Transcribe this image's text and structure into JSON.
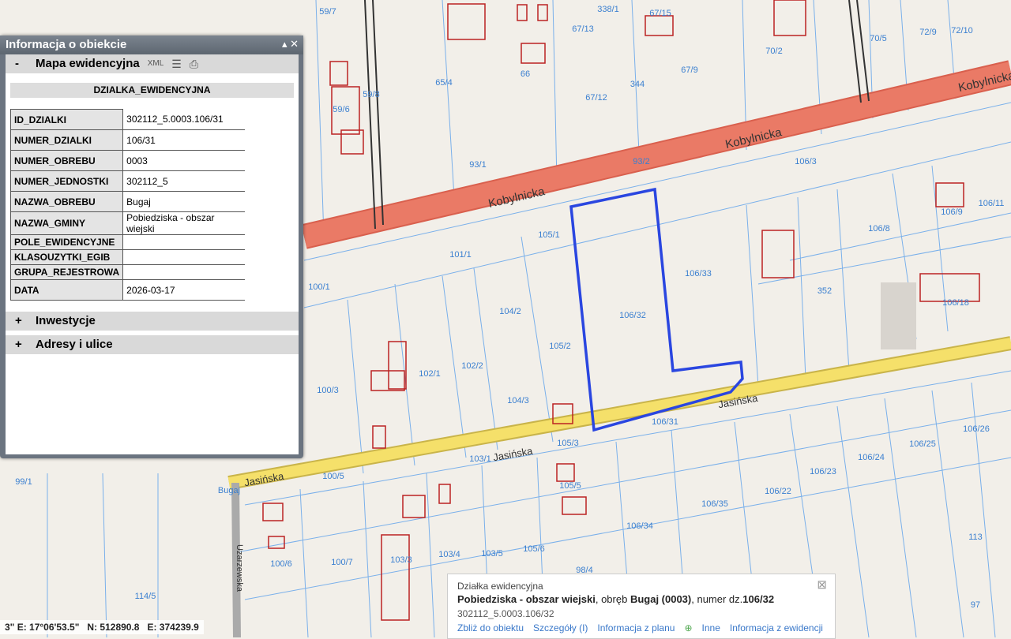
{
  "panel": {
    "title": "Informacja o obiekcie",
    "section": "Mapa ewidencyjna",
    "section_sign": "-",
    "xml": "XML",
    "dz_header": "DZIALKA_EWIDENCYJNA",
    "rows": [
      {
        "k": "ID_DZIALKI",
        "v": "302112_5.0003.106/31"
      },
      {
        "k": "NUMER_DZIALKI",
        "v": "106/31"
      },
      {
        "k": "NUMER_OBREBU",
        "v": "0003"
      },
      {
        "k": "NUMER_JEDNOSTKI",
        "v": "302112_5"
      },
      {
        "k": "NAZWA_OBREBU",
        "v": "Bugaj"
      },
      {
        "k": "NAZWA_GMINY",
        "v": "Pobiedziska - obszar wiejski"
      },
      {
        "k": "POLE_EWIDENCYJNE",
        "v": ""
      },
      {
        "k": "KLASOUZYTKI_EGIB",
        "v": ""
      },
      {
        "k": "GRUPA_REJESTROWA",
        "v": ""
      },
      {
        "k": "DATA",
        "v": "2026-03-17"
      }
    ],
    "sections": [
      {
        "sign": "+",
        "label": "Inwestycje"
      },
      {
        "sign": "+",
        "label": "Adresy i ulice"
      }
    ]
  },
  "popup": {
    "type": "Działka ewidencyjna",
    "gmina": "Pobiedziska - obszar wiejski",
    "obreb_prefix": ", obręb ",
    "obreb": "Bugaj (0003)",
    "numer_prefix": ", numer dz.",
    "numer": "106/32",
    "id": "302112_5.0003.106/32",
    "links": [
      "Zbliż do obiektu",
      "Szczegóły (I)",
      "Informacja z planu",
      "Inne",
      "Informacja z ewidencji"
    ]
  },
  "coords": "3\" E: 17°06'53.5\"   N: 512890.8   E: 374239.9",
  "map": {
    "streets": [
      "Kobylnicka",
      "Kobylnicka",
      "Kobylnicka",
      "Jasińska",
      "Jasińska",
      "Jasińska",
      "Uzarzewska"
    ],
    "parcels": [
      "59/7",
      "338/1",
      "67/15",
      "67/13",
      "70/2",
      "70/5",
      "72/9",
      "72/10",
      "65/4",
      "66",
      "67/12",
      "67/9",
      "344",
      "59/8",
      "59/6",
      "93/1",
      "93/2",
      "106/3",
      "105/1",
      "101/1",
      "106/33",
      "106/32",
      "352",
      "106/8",
      "106/9",
      "106/11",
      "106/18",
      "100/1",
      "104/2",
      "105/2",
      "102/1",
      "102/2",
      "100/3",
      "104/3",
      "106/31",
      "105/3",
      "103/1",
      "100/5",
      "105/5",
      "106/26",
      "106/25",
      "106/24",
      "106/23",
      "106/22",
      "106/35",
      "106/34",
      "113",
      "100/6",
      "100/7",
      "103/3",
      "103/4",
      "103/5",
      "105/6",
      "98/4",
      "114/5",
      "97",
      "99/1",
      "Bugaj"
    ]
  }
}
